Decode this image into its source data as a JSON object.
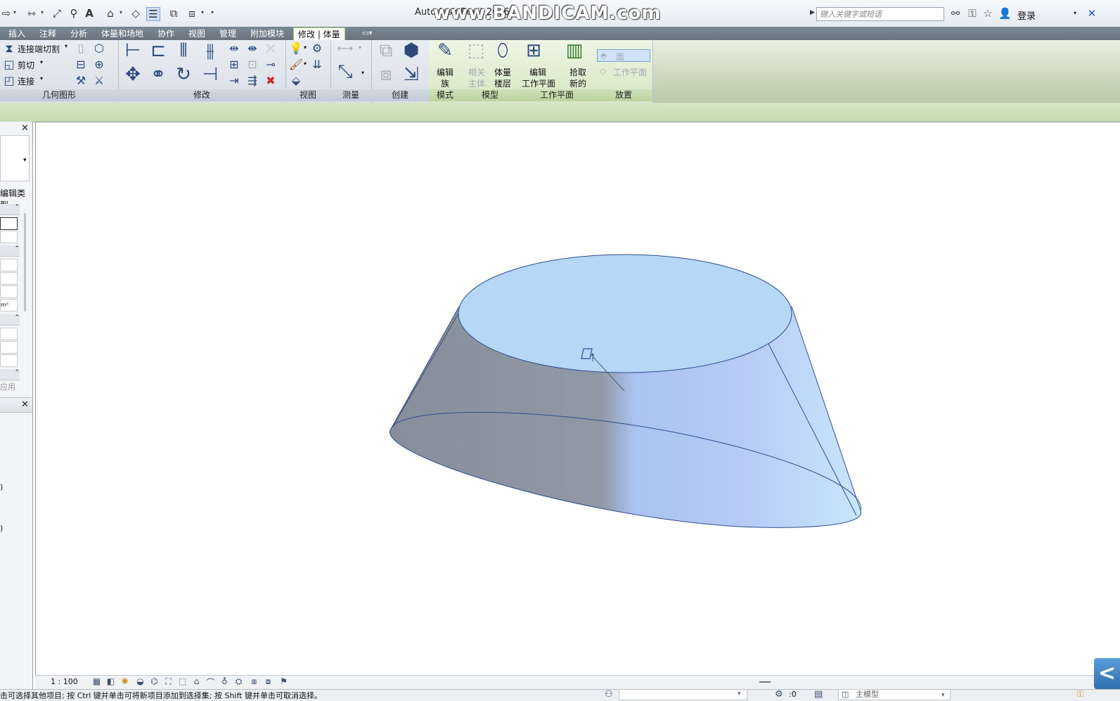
{
  "window": {
    "app_title": "Autodesk Revit 2016",
    "watermark": "www.BANDICAM.com",
    "search_placeholder": "键入关键字或短语",
    "login_label": "登录"
  },
  "tabs": [
    {
      "label": "插入"
    },
    {
      "label": "注释"
    },
    {
      "label": "分析"
    },
    {
      "label": "体量和场地"
    },
    {
      "label": "协作"
    },
    {
      "label": "视图"
    },
    {
      "label": "管理"
    },
    {
      "label": "附加模块"
    },
    {
      "label": "修改 | 体量",
      "active": true
    }
  ],
  "ribbon": {
    "geometry": {
      "cut_connect": "连接端切割",
      "cut": "剪切",
      "join": "连接",
      "label": "几何图形"
    },
    "modify_label": "修改",
    "view_label": "视图",
    "measure_label": "测量",
    "create_label": "创建",
    "mode": {
      "edit_family": "编辑\n族",
      "edit_family_l1": "编辑",
      "edit_family_l2": "族",
      "label": "模式"
    },
    "model": {
      "related_l1": "相关",
      "related_l2": "主体",
      "floors_l1": "体量",
      "floors_l2": "楼层",
      "label": "模型"
    },
    "workplane": {
      "edit_l1": "编辑",
      "edit_l2": "工作平面",
      "label": "工作平面"
    },
    "pick": {
      "l1": "拾取",
      "l2": "新的"
    },
    "placement": {
      "face": "面",
      "workplane": "工作平面",
      "label": "放置"
    }
  },
  "left_panel": {
    "edit_type": "编辑类型",
    "apply": "应用",
    "volume_unit": "m³"
  },
  "viewbar": {
    "scale": "1 : 100"
  },
  "statusbar": {
    "message": "击可选择其他项目; 按 Ctrl 键并单击可将新项目添加到选择集; 按 Shift 键并单击可取消选择。",
    "count": ":0",
    "main_model": "主模型"
  },
  "colors": {
    "mass_fill": "#a9cdf5",
    "mass_shadow": "#7e8795",
    "mass_edge": "#2c4f8c",
    "context_tab": "#9cd070"
  }
}
